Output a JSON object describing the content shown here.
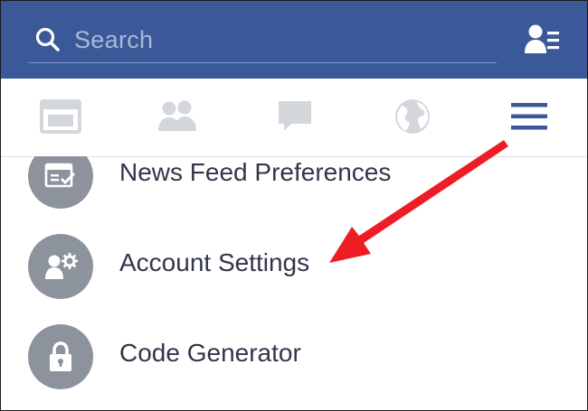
{
  "search": {
    "placeholder": "Search",
    "icon": "search-icon"
  },
  "header": {
    "friends_icon": "friend-requests-icon"
  },
  "tabs": [
    {
      "icon": "news-feed-icon"
    },
    {
      "icon": "friends-icon"
    },
    {
      "icon": "messages-icon"
    },
    {
      "icon": "notifications-globe-icon"
    },
    {
      "icon": "menu-icon",
      "active": true
    }
  ],
  "menu": {
    "items": [
      {
        "label": "News Feed Preferences",
        "icon": "news-feed-preferences-icon"
      },
      {
        "label": "Account Settings",
        "icon": "account-settings-icon"
      },
      {
        "label": "Code Generator",
        "icon": "lock-icon"
      }
    ]
  },
  "colors": {
    "brand_blue": "#3b5998",
    "tab_inactive": "#d3d6db",
    "tab_active": "#3b5998",
    "menu_icon_circle": "#8d939d",
    "label_text": "#33364a",
    "annotation_arrow": "#ee1c25"
  }
}
